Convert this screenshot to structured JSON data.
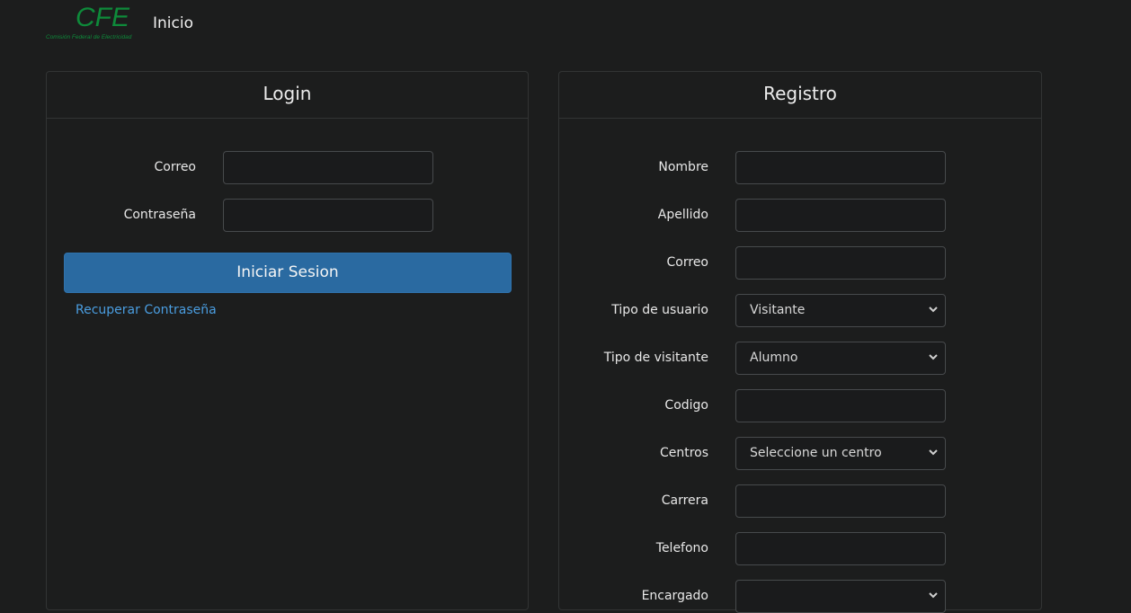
{
  "navbar": {
    "logo_text": "CFE",
    "logo_subtitle": "Comisión Federal de Electricidad",
    "home_link": "Inicio"
  },
  "login": {
    "title": "Login",
    "email_label": "Correo",
    "email_value": "",
    "password_label": "Contraseña",
    "password_value": "",
    "submit_label": "Iniciar Sesion",
    "recover_link": "Recuperar Contraseña"
  },
  "registro": {
    "title": "Registro",
    "fields": {
      "nombre_label": "Nombre",
      "apellido_label": "Apellido",
      "correo_label": "Correo",
      "tipo_usuario_label": "Tipo de usuario",
      "tipo_usuario_value": "Visitante",
      "tipo_visitante_label": "Tipo de visitante",
      "tipo_visitante_value": "Alumno",
      "codigo_label": "Codigo",
      "centros_label": "Centros",
      "centros_value": "Seleccione un centro",
      "carrera_label": "Carrera",
      "telefono_label": "Telefono",
      "encargado_label": "Encargado",
      "encargado_value": ""
    }
  },
  "colors": {
    "background": "#1c1d1d",
    "primary_button": "#2a6aa1",
    "link": "#4a9de0",
    "logo_green": "#0e8a3a"
  },
  "icons": {
    "select_arrow": "chevron-down-icon"
  }
}
